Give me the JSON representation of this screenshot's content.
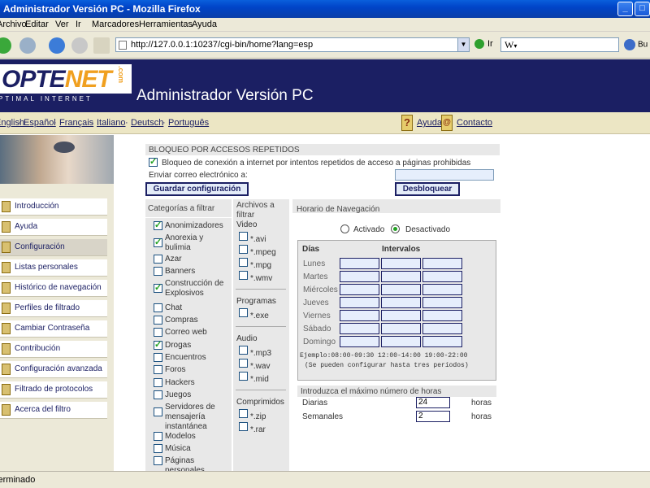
{
  "window": {
    "title": "Administrador Versión PC - Mozilla Firefox"
  },
  "menu": [
    "Archivo",
    "Editar",
    "Ver",
    "Ir",
    "Marcadores",
    "Herramientas",
    "Ayuda"
  ],
  "toolbar": {
    "url": "http://127.0.0.1:10237/cgi-bin/home?lang=esp",
    "go_label": "Ir",
    "search_value": "W",
    "search_button": "Bu"
  },
  "header": {
    "logo_text_a": "OPTE",
    "logo_text_b": "NET",
    "logo_dotcom": ".com",
    "logo_tagline": "PTIMAL INTERNET",
    "app_title": "Administrador Versión PC"
  },
  "languages": [
    "English",
    "Español",
    "Français",
    "Italiano",
    "Deutsch",
    "Português"
  ],
  "help": {
    "help_label": "Ayuda",
    "contact_label": "Contacto"
  },
  "sidebar": {
    "items": [
      {
        "label": "Introducción"
      },
      {
        "label": "Ayuda"
      },
      {
        "label": "Configuración"
      },
      {
        "label": "Listas personales"
      },
      {
        "label": "Histórico de navegación"
      },
      {
        "label": "Perfiles de filtrado"
      },
      {
        "label": "Cambiar Contraseña"
      },
      {
        "label": "Contribución"
      },
      {
        "label": "Configuración avanzada"
      },
      {
        "label": "Filtrado de protocolos"
      },
      {
        "label": "Acerca del filtro"
      }
    ]
  },
  "block": {
    "heading": "BLOQUEO POR ACCESOS REPETIDOS",
    "checkbox_label": "Bloqueo de conexión a internet por intentos repetidos de acceso a páginas prohibidas",
    "email_label": "Enviar correo electrónico a:",
    "email_value": "",
    "save_button": "Guardar configuración",
    "unlock_button": "Desbloquear"
  },
  "categories": {
    "heading": "Categorías a filtrar",
    "items": [
      {
        "label": "Anonimizadores",
        "checked": true
      },
      {
        "label": "Anorexia y bulimia",
        "checked": true
      },
      {
        "label": "Azar",
        "checked": false
      },
      {
        "label": "Banners",
        "checked": false
      },
      {
        "label": "Construcción de Explosivos",
        "checked": true
      },
      {
        "label": "Chat",
        "checked": false
      },
      {
        "label": "Compras",
        "checked": false
      },
      {
        "label": "Correo web",
        "checked": false
      },
      {
        "label": "Drogas",
        "checked": true
      },
      {
        "label": "Encuentros",
        "checked": false
      },
      {
        "label": "Foros",
        "checked": false
      },
      {
        "label": "Hackers",
        "checked": false
      },
      {
        "label": "Juegos",
        "checked": false
      },
      {
        "label": "Servidores de mensajería instantánea",
        "checked": false
      },
      {
        "label": "Modelos",
        "checked": false
      },
      {
        "label": "Música",
        "checked": false
      },
      {
        "label": "Páginas personales",
        "checked": false
      }
    ]
  },
  "files": {
    "heading": "Archivos a filtrar",
    "groups": [
      {
        "name": "Video",
        "items": [
          "*.avi",
          "*.mpeg",
          "*.mpg",
          "*.wmv"
        ]
      },
      {
        "name": "Programas",
        "items": [
          "*.exe"
        ]
      },
      {
        "name": "Audio",
        "items": [
          "*.mp3",
          "*.wav",
          "*.mid"
        ]
      },
      {
        "name": "Comprimidos",
        "items": [
          "*.zip",
          "*.rar"
        ]
      }
    ]
  },
  "schedule": {
    "heading": "Horario de Navegación",
    "activated": "Activado",
    "deactivated": "Desactivado",
    "selected": "Desactivado",
    "days_header": "Días",
    "intervals_header": "Intervalos",
    "days": [
      "Lunes",
      "Martes",
      "Miércoles",
      "Jueves",
      "Viernes",
      "Sábado",
      "Domingo"
    ],
    "example": "Ejemplo:08:00-09:30 12:00-14:00 19:00-22:00",
    "note": "(Se pueden configurar hasta tres períodos)"
  },
  "hours": {
    "heading": "Introduzca el máximo número de horas",
    "daily_label": "Diarias",
    "daily_value": "24",
    "weekly_label": "Semanales",
    "weekly_value": "2",
    "unit": "horas"
  },
  "status": {
    "text": "Terminado"
  },
  "colors": {
    "brand_dark": "#1b1f63",
    "brand_orange": "#f0a020",
    "check_green": "#21a121"
  }
}
